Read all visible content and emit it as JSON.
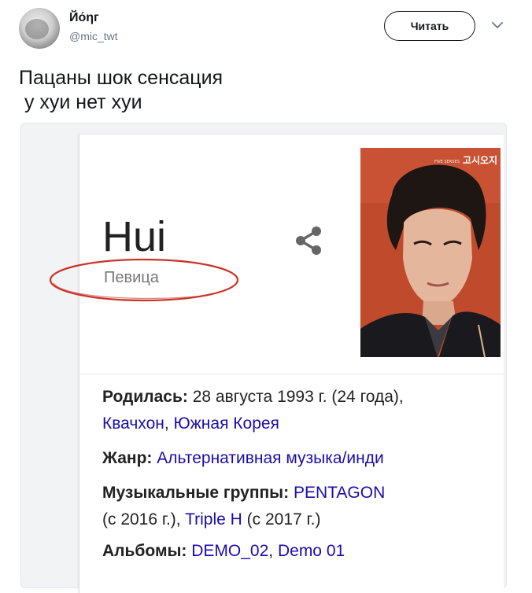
{
  "tweet": {
    "display_name": "Йо́ηг",
    "handle": "@mic_twt",
    "follow_label": "Читать",
    "text_line1": "Пацаны шок сенсация",
    "text_line2": " у хуи нет хуи"
  },
  "knowledge_panel": {
    "title": "Hui",
    "subtitle": "Певица",
    "born_label": "Родилась:",
    "born_value": " 28 августа 1993 г. (24 года),",
    "born_place_city": "Квачхон",
    "born_place_sep": ", ",
    "born_place_country": "Южная Корея",
    "genre_label": "Жанр:",
    "genre_value": "Альтернативная музыка/инди",
    "groups_label": "Музыкальные группы:",
    "group1": "PENTAGON",
    "group1_years": "(с 2016 г.), ",
    "group2": "Triple H",
    "group2_years": " (с 2017 г.)",
    "albums_label": "Альбомы:",
    "album1": "DEMO_02",
    "album_sep": ", ",
    "album2": "Demo 01"
  },
  "photo": {
    "magazine_title": "고시오지",
    "cover_caption": "FIVE SENSES"
  },
  "colors": {
    "link": "#1a0dab",
    "annotation_ellipse": "#c8342a",
    "photo_background": "#bf4a2c"
  }
}
